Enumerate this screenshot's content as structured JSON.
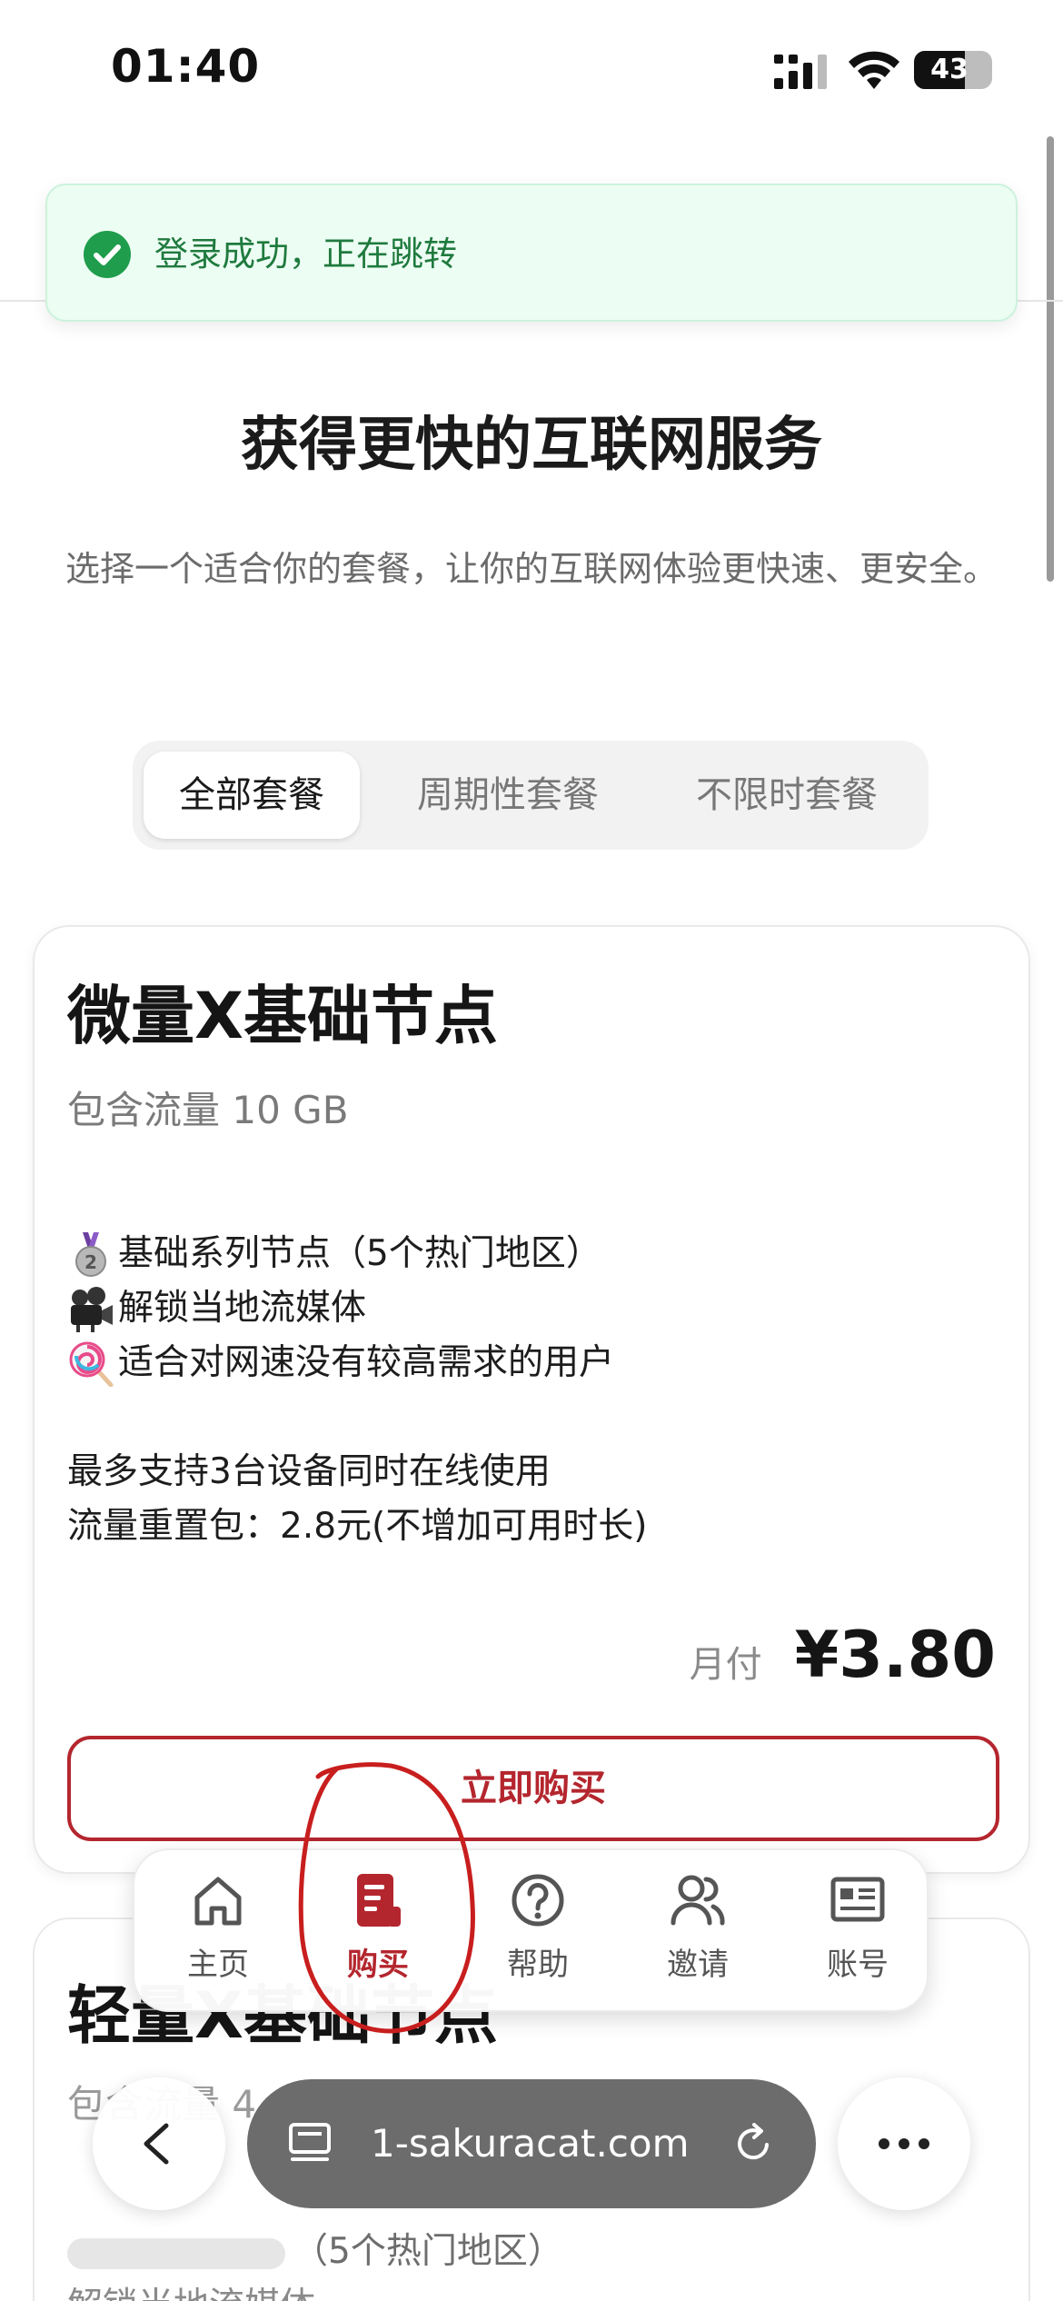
{
  "status_bar": {
    "time": "01:40",
    "battery": "43"
  },
  "toast": {
    "message": "登录成功，正在跳转",
    "icon": "check-circle-icon",
    "color": "#1f7a3e"
  },
  "hero": {
    "title": "获得更快的互联网服务",
    "subtitle": "选择一个适合你的套餐，让你的互联网体验更快速、更安全。"
  },
  "tabs": [
    {
      "label": "全部套餐",
      "active": true
    },
    {
      "label": "周期性套餐",
      "active": false
    },
    {
      "label": "不限时套餐",
      "active": false
    }
  ],
  "plans": [
    {
      "name": "微量X基础节点",
      "traffic": "包含流量 10 GB",
      "features": [
        {
          "icon": "second-place-medal-icon",
          "text": "基础系列节点（5个热门地区）"
        },
        {
          "icon": "movie-camera-icon",
          "text": "解锁当地流媒体"
        },
        {
          "icon": "lollipop-icon",
          "text": "适合对网速没有较高需求的用户"
        }
      ],
      "info": [
        "最多支持3台设备同时在线使用",
        "流量重置包：2.8元(不增加可用时长)"
      ],
      "price_period": "月付",
      "price": "¥3.80",
      "buy_label": "立即购买"
    },
    {
      "name": "轻量X基础节点",
      "traffic": "包含流量 4",
      "features_visible": [
        "（5个热门地区）",
        "解锁当地流媒体"
      ]
    }
  ],
  "bottom_nav": [
    {
      "label": "主页",
      "icon": "home-icon",
      "active": false
    },
    {
      "label": "购买",
      "icon": "receipt-icon",
      "active": true
    },
    {
      "label": "帮助",
      "icon": "question-circle-icon",
      "active": false
    },
    {
      "label": "邀请",
      "icon": "users-icon",
      "active": false
    },
    {
      "label": "账号",
      "icon": "account-card-icon",
      "active": false
    }
  ],
  "browser": {
    "url": "1-sakuracat.com"
  },
  "colors": {
    "accent": "#b4262e",
    "success_bg": "#ecfdf3",
    "success_text": "#1f7a3e"
  }
}
